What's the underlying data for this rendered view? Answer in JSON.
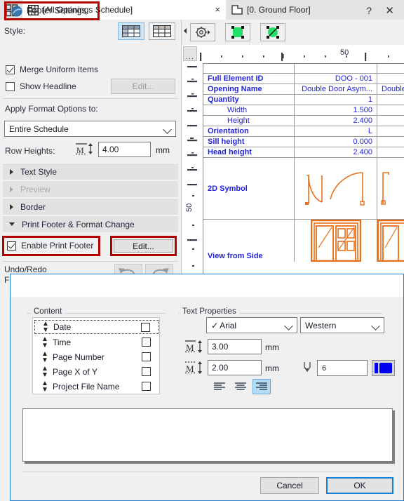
{
  "tabs": [
    {
      "label": "[All Openings Schedule]",
      "icon": "schedule-grid-icon",
      "active": true,
      "close": "×"
    },
    {
      "label": "[0. Ground Floor]",
      "icon": "floor-plan-icon",
      "active": false
    }
  ],
  "left_panel": {
    "style_label": "Style:",
    "style_buttons": [
      {
        "name": "style-option-1",
        "selected": true
      },
      {
        "name": "style-option-2",
        "selected": false
      }
    ],
    "merge_uniform_items": {
      "label": "Merge Uniform Items",
      "checked": true
    },
    "show_headline": {
      "label": "Show Headline",
      "checked": false
    },
    "edit_headline_button": "Edit...",
    "apply_format_label": "Apply Format Options to:",
    "apply_format_value": "Entire Schedule",
    "row_heights_label": "Row Heights:",
    "row_heights_value": "4.00",
    "row_heights_unit": "mm",
    "accordions": [
      {
        "label": "Text Style",
        "open": false,
        "disabled": false
      },
      {
        "label": "Preview",
        "open": false,
        "disabled": true
      },
      {
        "label": "Border",
        "open": false,
        "disabled": false
      },
      {
        "label": "Print Footer & Format Change",
        "open": true,
        "disabled": false
      }
    ],
    "enable_print_footer": {
      "label": "Enable Print Footer",
      "checked": true
    },
    "footer_edit_button": "Edit...",
    "undo_redo_label_line1": "Undo/Redo",
    "undo_redo_label_line2": "Format Change:",
    "highlight_color": "#b30000"
  },
  "schedule": {
    "ruler_h_label": "50",
    "ruler_v_label": "50",
    "corner_label": "...",
    "rows": [
      {
        "label": "",
        "value": "",
        "value2": "",
        "type": "blank"
      },
      {
        "label": "Full Element ID",
        "bold": true,
        "indent": false,
        "value": "DOO - 001",
        "value2": ""
      },
      {
        "label": "Opening Name",
        "bold": true,
        "indent": false,
        "value": "Double Door Asym...",
        "value2": "Double"
      },
      {
        "label": "Quantity",
        "bold": true,
        "indent": false,
        "value": "1",
        "value2": ""
      },
      {
        "label": "Width",
        "bold": false,
        "indent": true,
        "value": "1.500",
        "value2": ""
      },
      {
        "label": "Height",
        "bold": false,
        "indent": true,
        "value": "2.400",
        "value2": ""
      },
      {
        "label": "Orientation",
        "bold": true,
        "indent": false,
        "value": "L",
        "value2": ""
      },
      {
        "label": "Sill height",
        "bold": true,
        "indent": false,
        "value": "0.000",
        "value2": ""
      },
      {
        "label": "Head height",
        "bold": true,
        "indent": false,
        "value": "2.400",
        "value2": ""
      },
      {
        "label": "",
        "value": "",
        "value2": "",
        "type": "blank"
      }
    ],
    "symbol_row_label": "2D Symbol",
    "side_row_label": "View from Side",
    "symbol_color": "#e8701a",
    "text_color": "#2323dd"
  },
  "dialog": {
    "title": "Footer Settings",
    "help_glyph": "?",
    "close_glyph": "✕",
    "content_group_title": "Content",
    "content_items": [
      {
        "label": "Date",
        "checked": false,
        "focused": true
      },
      {
        "label": "Time",
        "checked": false,
        "focused": false
      },
      {
        "label": "Page Number",
        "checked": false,
        "focused": false
      },
      {
        "label": "Page X of Y",
        "checked": false,
        "focused": false
      },
      {
        "label": "Project File Name",
        "checked": false,
        "focused": false
      }
    ],
    "text_properties_group_title": "Text Properties",
    "font_family": "Arial",
    "font_checkmark": "✓",
    "script": "Western",
    "size_1": "3.00",
    "size_1_unit": "mm",
    "size_2": "2.00",
    "size_2_unit": "mm",
    "pen_number": "6",
    "pen_color": "#0000ee",
    "alignments": [
      {
        "name": "align-left",
        "selected": false
      },
      {
        "name": "align-center",
        "selected": false
      },
      {
        "name": "align-right",
        "selected": true
      }
    ],
    "cancel_button": "Cancel",
    "ok_button": "OK",
    "ok_accent": "#1a7fd4"
  }
}
